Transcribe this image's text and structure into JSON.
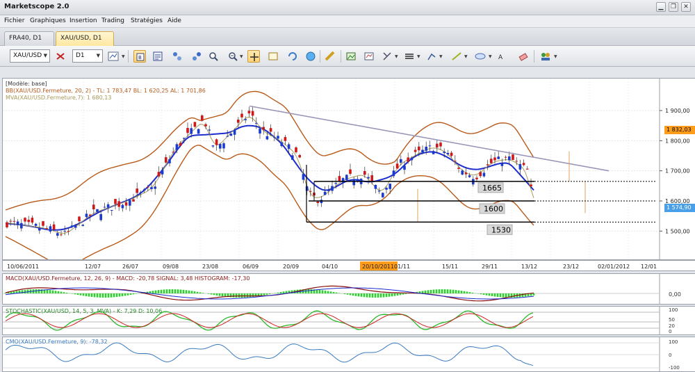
{
  "app": {
    "title": "Marketscope 2.0",
    "window_buttons": [
      "▁",
      "❐",
      "✕"
    ]
  },
  "menu": [
    "Fichier",
    "Graphiques",
    "Insertion",
    "Trading",
    "Stratégies",
    "Aide"
  ],
  "tabs": [
    {
      "label": "FRA40, D1",
      "active": false
    },
    {
      "label": "XAU/USD, D1",
      "active": true
    }
  ],
  "toolbar": {
    "instrument": "XAU/USD",
    "timeframe": "D1"
  },
  "colors": {
    "bull": "#1a3ad0",
    "bear": "#d01818",
    "bb": "#b85a1a",
    "bb_mid": "#1c2ccf",
    "mva": "#a89a5a",
    "trend": "#9a98b8",
    "price_tag": "#ff9c1a",
    "last_tag": "#4aa0e8",
    "macd_hist": "#2bd12b",
    "stoch_k": "#2ab82a",
    "stoch_d": "#cc2020",
    "cmo": "#3a7abf"
  },
  "main": {
    "legend": [
      "[Modèle: base]",
      "BB(XAU/USD.Fermeture, 20, 2) -  TL: 1 783,47  BL: 1 620,25  AL: 1 701,86",
      "MVA(XAU/USD.Fermeture,7): 1 680,13"
    ],
    "price_axis": [
      "1 900,00",
      "1 800,00",
      "1 700,00",
      "1 600,00",
      "1 500,00"
    ],
    "price_tag": "1 832,03",
    "last_price": "1 574,90",
    "levels": [
      {
        "label": "1665",
        "price": 1665
      },
      {
        "label": "1600",
        "price": 1600
      },
      {
        "label": "1530",
        "price": 1530
      }
    ]
  },
  "xaxis": {
    "labels": [
      "10/06/2011",
      "12/07",
      "26/07",
      "09/08",
      "23/08",
      "06/09",
      "20/09",
      "04/10",
      "20/10/2011",
      "01/11",
      "15/11",
      "29/11",
      "13/12",
      "23/12",
      "02/01/2012",
      "12/01"
    ],
    "highlight": "20/10/2011"
  },
  "macd": {
    "legend": "MACD(XAU/USD.Fermeture, 12, 26, 9) -  MACD: -20,78  SIGNAL: 3,48  HISTOGRAM: -17,30",
    "axis": [
      "0,00"
    ]
  },
  "stochastic": {
    "legend": "STOCHASTIC(XAU/USD, 14, 5, 3, MVA) -  K: 7,29  D: 10,06",
    "axis": [
      "100",
      "50",
      "20",
      "0"
    ]
  },
  "cmo": {
    "legend": "CMO(XAU/USD.Fermeture, 9): -78,32",
    "axis": [
      "100",
      "0",
      "-100"
    ]
  }
}
